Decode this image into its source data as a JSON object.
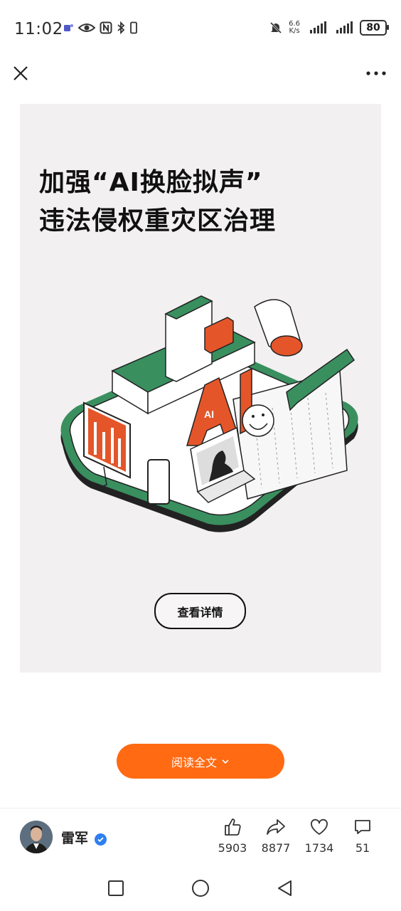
{
  "status_bar": {
    "time": "11:02",
    "net_speed_value": "6.6",
    "net_speed_unit": "K/s",
    "battery": "80"
  },
  "poster": {
    "title_line1": "加强“AI换脸拟声”",
    "title_line2": "违法侵权重灾区治理",
    "detail_button": "查看详情",
    "illustration_text": "AI"
  },
  "read_full_button": "阅读全文",
  "author": {
    "name": "雷军"
  },
  "actions": {
    "like_count": "5903",
    "share_count": "8877",
    "favorite_count": "1734",
    "comment_count": "51"
  },
  "colors": {
    "accent_orange": "#ff6a13",
    "illustration_green": "#3a8f5f",
    "illustration_orange": "#e4562a",
    "poster_bg": "#f2f0f1",
    "verified_blue": "#2e7ff0"
  }
}
